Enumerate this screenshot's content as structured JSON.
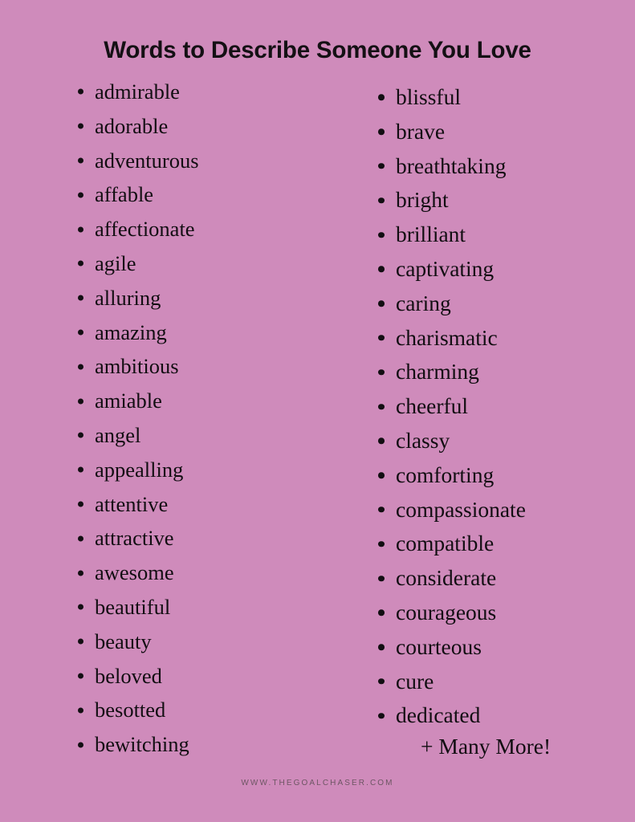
{
  "theme": {
    "background_color": "#cf8bbb",
    "text_color": "#120e12",
    "title_color": "#141014",
    "watermark_color": "#6d5663"
  },
  "header": {
    "title": "Words to Describe Someone You Love"
  },
  "main": {
    "columns": [
      {
        "id": "left",
        "items": [
          "admirable",
          "adorable",
          "adventurous",
          "affable",
          "affectionate",
          "agile",
          "alluring",
          "amazing",
          "ambitious",
          "amiable",
          "angel",
          "appealling",
          "attentive",
          "attractive",
          "awesome",
          "beautiful",
          "beauty",
          "beloved",
          "besotted",
          "bewitching"
        ]
      },
      {
        "id": "right",
        "items": [
          "blissful",
          "brave",
          "breathtaking",
          "bright",
          "brilliant",
          "captivating",
          "caring",
          "charismatic",
          "charming",
          "cheerful",
          "classy",
          "comforting",
          "compassionate",
          "compatible",
          "considerate",
          "courageous",
          "courteous",
          "cure",
          "dedicated"
        ]
      }
    ],
    "many_more_label": "+ Many More!"
  },
  "footer": {
    "watermark": "WWW.THEGOALCHASER.COM"
  }
}
